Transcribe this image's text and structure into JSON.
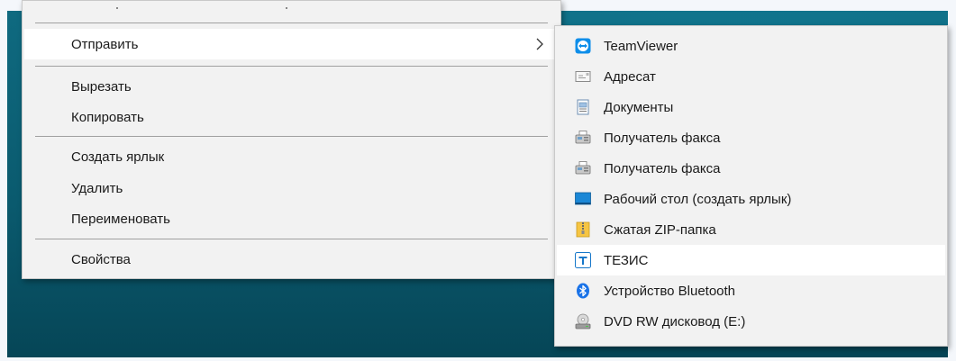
{
  "context_menu": {
    "items": [
      {
        "label": "Отправить",
        "has_submenu": true
      },
      {
        "label": "Вырезать"
      },
      {
        "label": "Копировать"
      },
      {
        "label": "Создать ярлык"
      },
      {
        "label": "Удалить"
      },
      {
        "label": "Переименовать"
      },
      {
        "label": "Свойства"
      }
    ]
  },
  "send_to_submenu": {
    "items": [
      {
        "label": "TeamViewer",
        "icon": "teamviewer-icon"
      },
      {
        "label": "Адресат",
        "icon": "mail-recipient-icon"
      },
      {
        "label": "Документы",
        "icon": "documents-icon"
      },
      {
        "label": "Получатель факса",
        "icon": "fax-icon"
      },
      {
        "label": "Получатель факса",
        "icon": "fax-icon"
      },
      {
        "label": "Рабочий стол (создать ярлык)",
        "icon": "desktop-icon"
      },
      {
        "label": "Сжатая ZIP-папка",
        "icon": "zip-folder-icon"
      },
      {
        "label": "ТЕЗИС",
        "icon": "tezis-icon",
        "hovered": true
      },
      {
        "label": "Устройство Bluetooth",
        "icon": "bluetooth-icon"
      },
      {
        "label": "DVD RW дисковод (E:)",
        "icon": "dvd-drive-icon"
      }
    ]
  },
  "colors": {
    "menu_bg": "#f2f2f2",
    "hover_bg": "#ffffff",
    "desktop": "#0a5a6e",
    "teamviewer_blue": "#0e8ee9",
    "bluetooth_blue": "#1a73e8"
  }
}
